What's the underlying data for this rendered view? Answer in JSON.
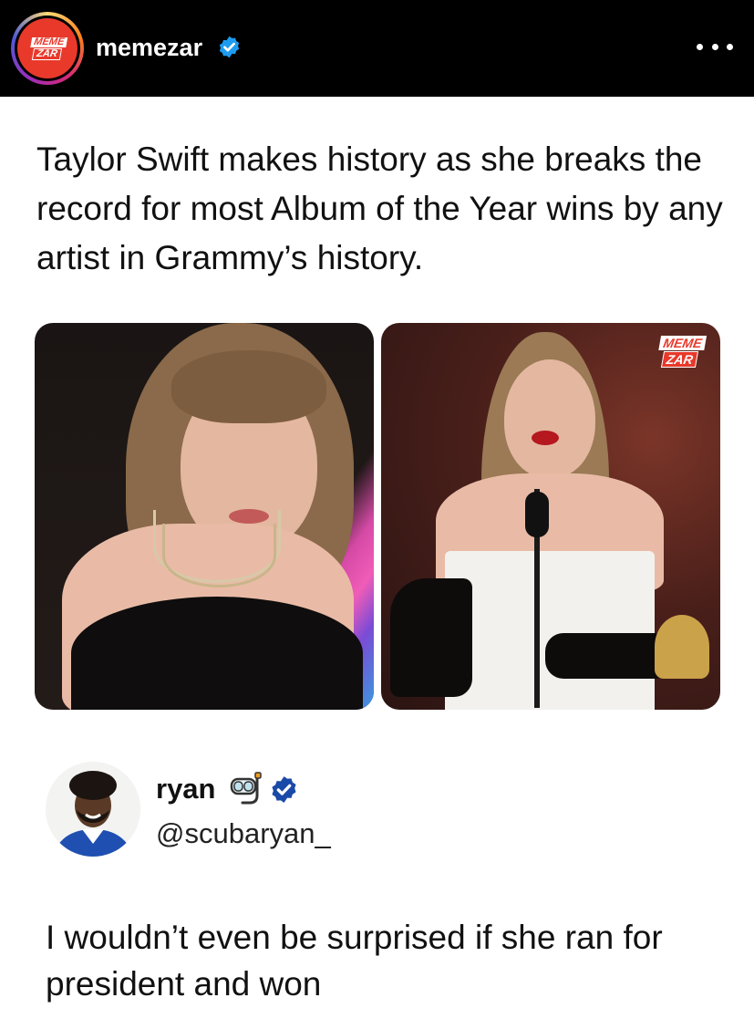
{
  "post": {
    "username": "memezar",
    "logo_line1": "MEME",
    "logo_line2": "ZAR",
    "caption": "Taylor Swift makes history as she breaks the record for most Album of the Year wins by any artist in Grammy’s history."
  },
  "images": {
    "watermark_line1": "MEME",
    "watermark_line2": "ZAR"
  },
  "tweet": {
    "name": "ryan",
    "emoji": "🤿",
    "handle": "@scubaryan_",
    "body": "I wouldn’t even be surprised if she ran for president and won"
  },
  "icons": {
    "verified": "verified-badge-icon",
    "more": "more-options-icon",
    "snorkel": "diving-mask-icon"
  },
  "colors": {
    "header_bg": "#000000",
    "verified_blue": "#1d9bf0",
    "brand_red": "#e8392b"
  }
}
